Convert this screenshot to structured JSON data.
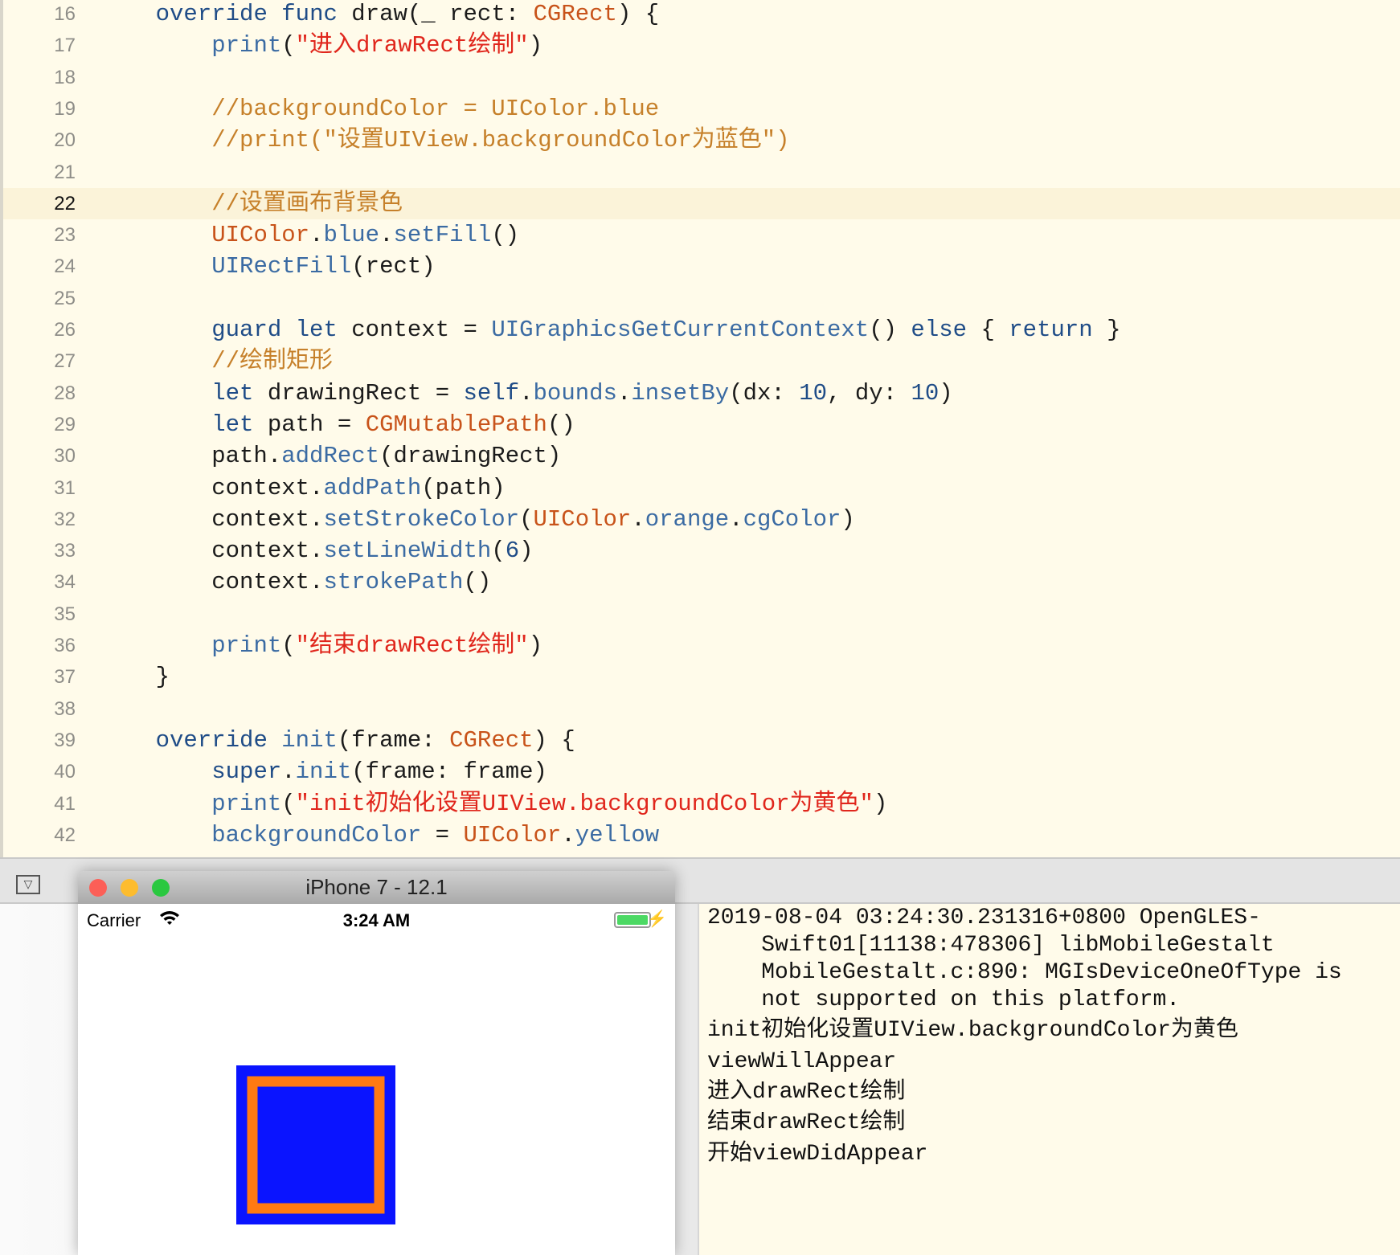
{
  "editor": {
    "current_line": 22,
    "lines": [
      {
        "n": 16,
        "t": [
          [
            "pl",
            "    "
          ],
          [
            "kw",
            "override"
          ],
          [
            "pl",
            " "
          ],
          [
            "kw",
            "func"
          ],
          [
            "pl",
            " draw(_ rect: "
          ],
          [
            "ty",
            "CGRect"
          ],
          [
            "pl",
            ") {"
          ]
        ]
      },
      {
        "n": 17,
        "t": [
          [
            "pl",
            "        "
          ],
          [
            "fn",
            "print"
          ],
          [
            "pl",
            "("
          ],
          [
            "st",
            "\"进入drawRect绘制\""
          ],
          [
            "pl",
            ")"
          ]
        ]
      },
      {
        "n": 18,
        "t": []
      },
      {
        "n": 19,
        "t": [
          [
            "pl",
            "        "
          ],
          [
            "cm",
            "//backgroundColor = UIColor.blue"
          ]
        ]
      },
      {
        "n": 20,
        "t": [
          [
            "pl",
            "        "
          ],
          [
            "cm",
            "//print(\"设置UIView.backgroundColor为蓝色\")"
          ]
        ]
      },
      {
        "n": 21,
        "t": []
      },
      {
        "n": 22,
        "t": [
          [
            "pl",
            "        "
          ],
          [
            "cm",
            "//设置画布背景色"
          ]
        ]
      },
      {
        "n": 23,
        "t": [
          [
            "pl",
            "        "
          ],
          [
            "ty",
            "UIColor"
          ],
          [
            "pl",
            "."
          ],
          [
            "fn",
            "blue"
          ],
          [
            "pl",
            "."
          ],
          [
            "fn",
            "setFill"
          ],
          [
            "pl",
            "()"
          ]
        ]
      },
      {
        "n": 24,
        "t": [
          [
            "pl",
            "        "
          ],
          [
            "fn",
            "UIRectFill"
          ],
          [
            "pl",
            "(rect)"
          ]
        ]
      },
      {
        "n": 25,
        "t": []
      },
      {
        "n": 26,
        "t": [
          [
            "pl",
            "        "
          ],
          [
            "kw",
            "guard"
          ],
          [
            "pl",
            " "
          ],
          [
            "kw",
            "let"
          ],
          [
            "pl",
            " context = "
          ],
          [
            "fn",
            "UIGraphicsGetCurrentContext"
          ],
          [
            "pl",
            "() "
          ],
          [
            "kw",
            "else"
          ],
          [
            "pl",
            " { "
          ],
          [
            "kw",
            "return"
          ],
          [
            "pl",
            " }"
          ]
        ]
      },
      {
        "n": 27,
        "t": [
          [
            "pl",
            "        "
          ],
          [
            "cm",
            "//绘制矩形"
          ]
        ]
      },
      {
        "n": 28,
        "t": [
          [
            "pl",
            "        "
          ],
          [
            "kw",
            "let"
          ],
          [
            "pl",
            " drawingRect = "
          ],
          [
            "kw",
            "self"
          ],
          [
            "pl",
            "."
          ],
          [
            "fn",
            "bounds"
          ],
          [
            "pl",
            "."
          ],
          [
            "fn",
            "insetBy"
          ],
          [
            "pl",
            "(dx: "
          ],
          [
            "nu",
            "10"
          ],
          [
            "pl",
            ", dy: "
          ],
          [
            "nu",
            "10"
          ],
          [
            "pl",
            ")"
          ]
        ]
      },
      {
        "n": 29,
        "t": [
          [
            "pl",
            "        "
          ],
          [
            "kw",
            "let"
          ],
          [
            "pl",
            " path = "
          ],
          [
            "ty",
            "CGMutablePath"
          ],
          [
            "pl",
            "()"
          ]
        ]
      },
      {
        "n": 30,
        "t": [
          [
            "pl",
            "        path."
          ],
          [
            "fn",
            "addRect"
          ],
          [
            "pl",
            "(drawingRect)"
          ]
        ]
      },
      {
        "n": 31,
        "t": [
          [
            "pl",
            "        context."
          ],
          [
            "fn",
            "addPath"
          ],
          [
            "pl",
            "(path)"
          ]
        ]
      },
      {
        "n": 32,
        "t": [
          [
            "pl",
            "        context."
          ],
          [
            "fn",
            "setStrokeColor"
          ],
          [
            "pl",
            "("
          ],
          [
            "ty",
            "UIColor"
          ],
          [
            "pl",
            "."
          ],
          [
            "fn",
            "orange"
          ],
          [
            "pl",
            "."
          ],
          [
            "fn",
            "cgColor"
          ],
          [
            "pl",
            ")"
          ]
        ]
      },
      {
        "n": 33,
        "t": [
          [
            "pl",
            "        context."
          ],
          [
            "fn",
            "setLineWidth"
          ],
          [
            "pl",
            "("
          ],
          [
            "nu",
            "6"
          ],
          [
            "pl",
            ")"
          ]
        ]
      },
      {
        "n": 34,
        "t": [
          [
            "pl",
            "        context."
          ],
          [
            "fn",
            "strokePath"
          ],
          [
            "pl",
            "()"
          ]
        ]
      },
      {
        "n": 35,
        "t": []
      },
      {
        "n": 36,
        "t": [
          [
            "pl",
            "        "
          ],
          [
            "fn",
            "print"
          ],
          [
            "pl",
            "("
          ],
          [
            "st",
            "\"结束drawRect绘制\""
          ],
          [
            "pl",
            ")"
          ]
        ]
      },
      {
        "n": 37,
        "t": [
          [
            "pl",
            "    }"
          ]
        ]
      },
      {
        "n": 38,
        "t": []
      },
      {
        "n": 39,
        "t": [
          [
            "pl",
            "    "
          ],
          [
            "kw",
            "override"
          ],
          [
            "pl",
            " "
          ],
          [
            "fn",
            "init"
          ],
          [
            "pl",
            "(frame: "
          ],
          [
            "ty",
            "CGRect"
          ],
          [
            "pl",
            ") {"
          ]
        ]
      },
      {
        "n": 40,
        "t": [
          [
            "pl",
            "        "
          ],
          [
            "kw",
            "super"
          ],
          [
            "pl",
            "."
          ],
          [
            "fn",
            "init"
          ],
          [
            "pl",
            "(frame: frame)"
          ]
        ]
      },
      {
        "n": 41,
        "t": [
          [
            "pl",
            "        "
          ],
          [
            "fn",
            "print"
          ],
          [
            "pl",
            "("
          ],
          [
            "st",
            "\"init初始化设置UIView.backgroundColor为黄色\""
          ],
          [
            "pl",
            ")"
          ]
        ]
      },
      {
        "n": 42,
        "t": [
          [
            "pl",
            "        "
          ],
          [
            "fn",
            "backgroundColor"
          ],
          [
            "pl",
            " = "
          ],
          [
            "ty",
            "UIColor"
          ],
          [
            "pl",
            "."
          ],
          [
            "fn",
            "yellow"
          ]
        ]
      }
    ]
  },
  "debug": {
    "toggle_icon": "hide-debug-area-icon"
  },
  "simulator": {
    "title": "iPhone 7 - 12.1",
    "carrier": "Carrier",
    "time": "3:24 AM",
    "battery_level": 1.0,
    "fill_color": "#0a14ff",
    "stroke_color": "#ff7a12"
  },
  "console": {
    "lines": [
      "2019-08-04 03:24:30.231316+0800 OpenGLES-",
      "    Swift01[11138:478306] libMobileGestalt",
      "    MobileGestalt.c:890: MGIsDeviceOneOfType is",
      "    not supported on this platform.",
      "init初始化设置UIView.backgroundColor为黄色",
      "viewWillAppear",
      "进入drawRect绘制",
      "结束drawRect绘制",
      "开始viewDidAppear"
    ]
  }
}
